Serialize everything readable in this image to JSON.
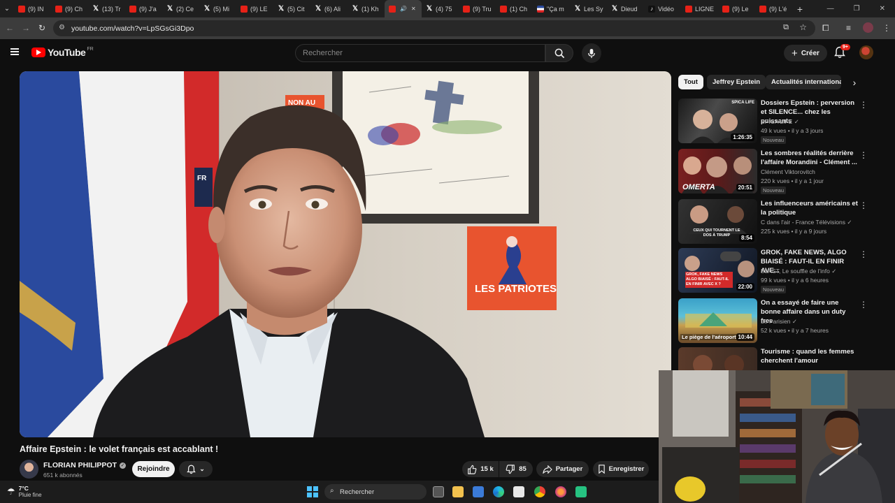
{
  "browser": {
    "tabs": [
      {
        "label": "(9) IN",
        "icon": "youtube-icon"
      },
      {
        "label": "(9) Ch",
        "icon": "youtube-icon"
      },
      {
        "label": "(13) Tr",
        "icon": "x-icon"
      },
      {
        "label": "(9) J'a",
        "icon": "youtube-icon"
      },
      {
        "label": "(2) Ce",
        "icon": "x-icon"
      },
      {
        "label": "(5) Mi",
        "icon": "x-icon"
      },
      {
        "label": "(9) LE",
        "icon": "youtube-icon"
      },
      {
        "label": "(5) Cit",
        "icon": "x-icon"
      },
      {
        "label": "(6) Ali",
        "icon": "x-icon"
      },
      {
        "label": "(1) Kh",
        "icon": "x-icon"
      },
      {
        "label": "",
        "icon": "youtube-icon",
        "active": true
      },
      {
        "label": "(4) 75",
        "icon": "x-icon"
      },
      {
        "label": "(9) Tru",
        "icon": "youtube-icon"
      },
      {
        "label": "(1) Ch",
        "icon": "youtube-icon"
      },
      {
        "label": "\"Ça m",
        "icon": "flag-icon"
      },
      {
        "label": "Les Sy",
        "icon": "x-icon"
      },
      {
        "label": "Dieud",
        "icon": "x-icon"
      },
      {
        "label": "Vidéo",
        "icon": "tiktok-icon"
      },
      {
        "label": "LIGNE",
        "icon": "youtube-icon"
      },
      {
        "label": "(9) Le",
        "icon": "youtube-icon"
      },
      {
        "label": "(9) L'é",
        "icon": "youtube-icon"
      }
    ],
    "url": "youtube.com/watch?v=LpSGsGi3Dpo"
  },
  "youtube": {
    "logo_text": "YouTube",
    "region": "FR",
    "search_placeholder": "Rechercher",
    "create_label": "Créer",
    "notif_count": "9+"
  },
  "video": {
    "title": "Affaire Epstein : le volet français est accablant !",
    "channel_name": "FLORIAN PHILIPPOT",
    "subscribers": "651 k abonnés",
    "join_label": "Rejoindre",
    "likes": "15 k",
    "dislikes": "85",
    "share_label": "Partager",
    "save_label": "Enregistrer",
    "poster_top_text": "NON AU",
    "poster_side_text": "FR",
    "sign_text": "LES PATRIOTES"
  },
  "chips": [
    {
      "label": "Tout",
      "active": true
    },
    {
      "label": "Jeffrey Epstein",
      "active": false
    },
    {
      "label": "Actualités internationales",
      "active": false
    }
  ],
  "recommendations": [
    {
      "title": "Dossiers  Epstein : perversion et SILENCE... chez les puissants",
      "channel": "SPICA LIFE",
      "verified": true,
      "meta": "49 k vues • il y a 3 jours",
      "badge": "Nouveau",
      "duration": "1:26:35",
      "thumb_text": "SPICA LIFE"
    },
    {
      "title": "Les sombres réalités derrière l'affaire Morandini - Clément ...",
      "channel": "Clément Viktorovitch",
      "verified": false,
      "meta": "220 k vues • il y a 1 jour",
      "badge": "Nouveau",
      "duration": "20:51",
      "thumb_text": "OMERTA"
    },
    {
      "title": "Les influenceurs américains et la politique",
      "channel": "C dans l'air - France Télévisions",
      "verified": true,
      "meta": "225 k vues • il y a 9 jours",
      "badge": "",
      "duration": "8:54",
      "thumb_text": "CEUX QUI TOURNENT LE DOS À TRUMP"
    },
    {
      "title": "GROK, FAKE NEWS, ALGO BIAISÉ : FAUT-IL EN FINIR AVE...",
      "channel": "BLAST, Le souffle de l'info",
      "verified": true,
      "meta": "99 k vues • il y a 6 heures",
      "badge": "Nouveau",
      "duration": "22:00",
      "thumb_text": "GROK, FAKE NEWS ALGO BIAISÉ : FAUT-IL EN FINIR AVEC X ?"
    },
    {
      "title": "On a essayé de faire une bonne affaire dans un duty free",
      "channel": "Le Parisien",
      "verified": true,
      "meta": "52 k vues • il y a 7 heures",
      "badge": "",
      "duration": "10:44",
      "thumb_text": "Le piège de l'aéroport"
    },
    {
      "title": "Tourisme : quand les femmes cherchent l'amour",
      "channel": "",
      "verified": false,
      "meta": "",
      "badge": "",
      "duration": "",
      "thumb_text": ""
    }
  ],
  "taskbar": {
    "weather_temp": "7°C",
    "weather_desc": "Pluie fine",
    "search_label": "Rechercher"
  },
  "colors": {
    "youtube_red": "#ff0000",
    "sign_orange": "#e8542f",
    "flag_blue": "#2a4a9e",
    "flag_red": "#d22a2a"
  }
}
